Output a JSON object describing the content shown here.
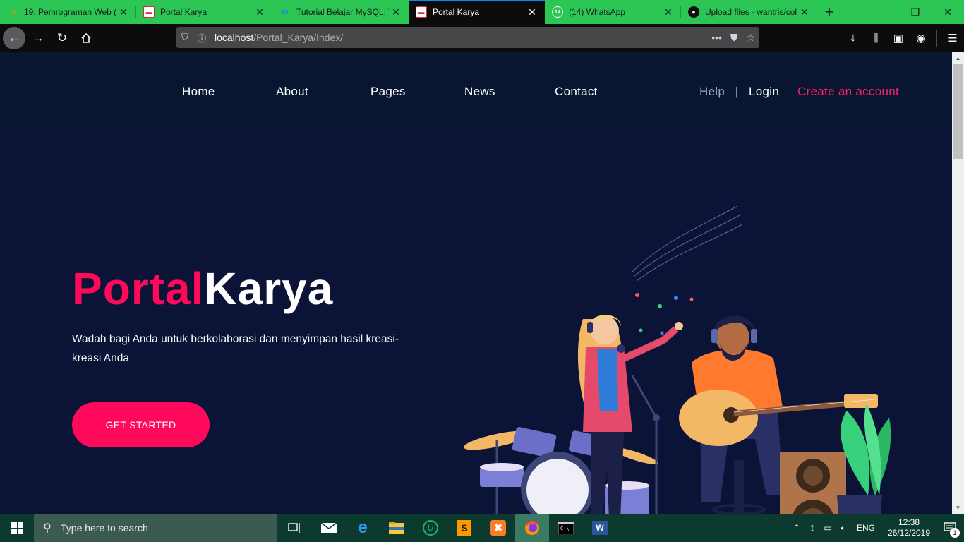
{
  "browser": {
    "tabs": [
      {
        "title": "19. Pemrograman Web (F",
        "favicon": "moodle-icon",
        "active": false
      },
      {
        "title": "Portal Karya",
        "favicon": "page-icon",
        "active": false
      },
      {
        "title": "Tutorial Belajar MySQL: T",
        "favicon": "duniailkom-icon",
        "active": false
      },
      {
        "title": "Portal Karya",
        "favicon": "page-icon",
        "active": true
      },
      {
        "title": "(14) WhatsApp",
        "favicon": "whatsapp-icon",
        "active": false
      },
      {
        "title": "Upload files · wantris/col",
        "favicon": "github-icon",
        "active": false
      }
    ],
    "close_glyph": "✕",
    "new_tab_glyph": "+",
    "url": {
      "host": "localhost",
      "path": "/Portal_Karya/Index/"
    },
    "accent": "#0a84ff",
    "tabbar_color": "#2bc653"
  },
  "nav": {
    "home": "Home",
    "about": "About",
    "pages": "Pages",
    "news": "News",
    "contact": "Contact",
    "help": "Help",
    "divider": "|",
    "login": "Login",
    "create_account": "Create an account"
  },
  "hero": {
    "brand_part1": "Portal",
    "brand_part2": "Karya",
    "tagline": "Wadah bagi Anda untuk berkolaborasi dan menyimpan hasil kreasi-kreasi Anda",
    "cta_label": "GET STARTED",
    "accent_color": "#ff0a5a",
    "background_color": "#0b1437"
  },
  "taskbar": {
    "search_placeholder": "Type here to search",
    "language": "ENG",
    "time": "12:38",
    "date": "26/12/2019",
    "notification_count": "1"
  }
}
